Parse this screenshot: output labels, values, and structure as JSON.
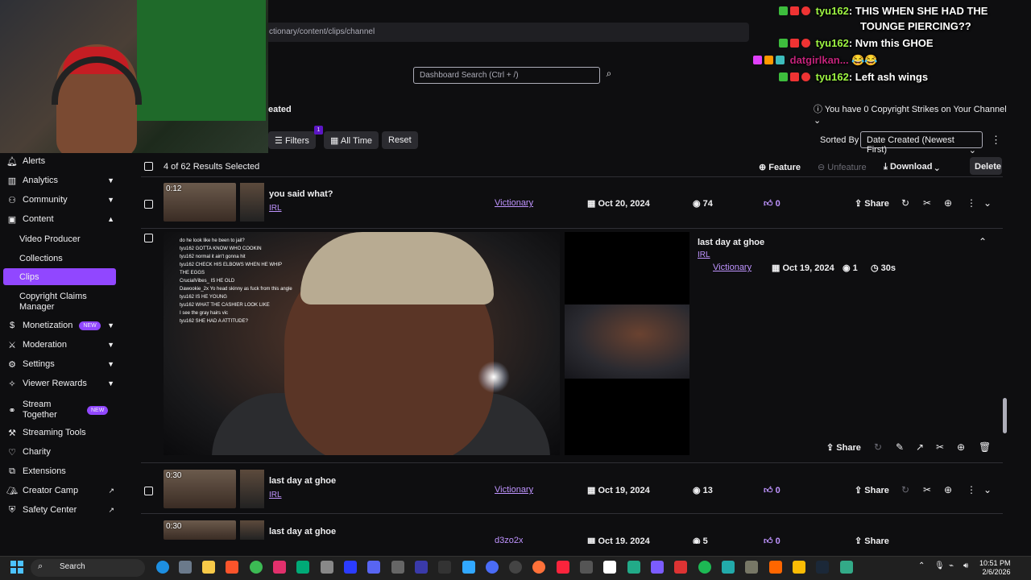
{
  "browser": {
    "url": "ctionary/content/clips/channel",
    "search_placeholder": "Dashboard Search (Ctrl + /)"
  },
  "chat": [
    {
      "user": "tyu162",
      "message": "THIS WHEN SHE HAD THE"
    },
    {
      "user": "",
      "message": "TOUNGE PIERCING??"
    },
    {
      "user": "tyu162",
      "message": "Nvm this GHOE"
    },
    {
      "user": "datgirlkan...",
      "message": "😂😂"
    },
    {
      "user": "tyu162",
      "message": "Left ash wings"
    }
  ],
  "header": {
    "title_fragment": "eated",
    "copyright": "You have 0 Copyright Strikes on Your Channel"
  },
  "toolbar": {
    "filters": "Filters",
    "filters_count": "1",
    "all_time": "All Time",
    "reset": "Reset",
    "sorted_by": "Sorted By",
    "sort_value": "Date Created (Newest First)"
  },
  "sidebar": {
    "items": [
      {
        "label": "Alerts",
        "icon": "bell-icon"
      },
      {
        "label": "Analytics",
        "icon": "chart-icon"
      },
      {
        "label": "Community",
        "icon": "people-icon"
      },
      {
        "label": "Content",
        "icon": "content-icon"
      },
      {
        "label": "Video Producer"
      },
      {
        "label": "Collections"
      },
      {
        "label": "Clips"
      },
      {
        "label": "Copyright Claims Manager"
      },
      {
        "label": "Monetization",
        "badge": "NEW"
      },
      {
        "label": "Moderation"
      },
      {
        "label": "Settings"
      },
      {
        "label": "Viewer Rewards"
      },
      {
        "label": "Stream Together",
        "badge": "NEW"
      },
      {
        "label": "Streaming Tools"
      },
      {
        "label": "Charity"
      },
      {
        "label": "Extensions"
      },
      {
        "label": "Creator Camp"
      },
      {
        "label": "Safety Center"
      }
    ]
  },
  "table": {
    "selected": "4 of 62 Results Selected",
    "feature": "Feature",
    "unfeature": "Unfeature",
    "download": "Download",
    "delete": "Delete",
    "rows": [
      {
        "duration": "0:12",
        "title": "you said what?",
        "tag": "IRL",
        "creator": "Victionary",
        "date": "Oct 20, 2024",
        "views": "74",
        "likes": "0",
        "share": "Share"
      },
      {
        "duration": "0:30",
        "title": "last day at ghoe",
        "tag": "IRL",
        "creator": "Victionary",
        "date": "Oct 19, 2024",
        "views": "13",
        "likes": "0",
        "share": "Share"
      },
      {
        "duration": "0:30",
        "title": "last day at ghoe",
        "tag": "",
        "creator": "d3zo2x",
        "date": "Oct 19, 2024",
        "views": "5",
        "likes": "0",
        "share": "Share"
      }
    ],
    "expanded": {
      "title": "last day at ghoe",
      "tag": "IRL",
      "creator": "Victionary",
      "date": "Oct 19, 2024",
      "views": "1",
      "length": "30s",
      "share": "Share"
    }
  },
  "overlay_chat": [
    "do he look like he been to jail?",
    "tyu162  GOTTA KNOW WHO COOKIN",
    "tyu162  normal it ain't gonna hit",
    "tyu162  CHECK HIS ELBOWS WHEN HE WHIP",
    "THE EGGS",
    "CrucialVibes_  IS HE OLD",
    "Dawookie_2x  Yo head skinny as fuck from this angle",
    "tyu162  IS HE YOUNG",
    "tyu162  WHAT THE CASHIER LOOK LIKE",
    "I see the gray hairs vic",
    "tyu162  SHE HAD A ATTITUDE?"
  ],
  "taskbar": {
    "search": "Search",
    "time": "10:51 PM",
    "date": "2/6/2026"
  },
  "colors": {
    "accent": "#9147ff",
    "link": "#bf94ff",
    "background": "#0e0e10"
  }
}
